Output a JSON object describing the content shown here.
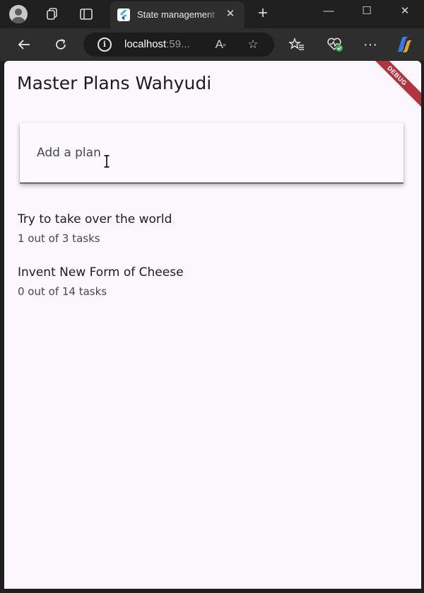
{
  "browser": {
    "tab": {
      "title": "State management",
      "close_glyph": "✕",
      "favicon": "flutter-icon"
    },
    "new_tab_glyph": "+",
    "window_controls": {
      "minimize": "—",
      "maximize": "☐",
      "close": "✕"
    },
    "address": {
      "host": "localhost",
      "port": ":59..."
    },
    "icons": [
      "profile-icon",
      "workspaces-icon",
      "tab-actions-icon",
      "back-icon",
      "refresh-icon",
      "info-icon",
      "read-aloud-icon",
      "favorite-icon",
      "favorites-icon",
      "browser-essentials-icon",
      "more-icon",
      "copilot-icon"
    ]
  },
  "app": {
    "debug_banner": "DEBUG",
    "title": "Master Plans Wahyudi",
    "input": {
      "placeholder": "Add a plan"
    },
    "plans": [
      {
        "name": "Try to take over the world",
        "progress": "1 out of 3 tasks"
      },
      {
        "name": "Invent New Form of Cheese",
        "progress": "0 out of 14 tasks"
      }
    ]
  },
  "colors": {
    "page_background": "#fbf7fc",
    "browser_chrome": "#2e2e2e",
    "debug_banner": "#b13540",
    "text_primary": "#1d1b20",
    "text_secondary": "#49454f"
  }
}
